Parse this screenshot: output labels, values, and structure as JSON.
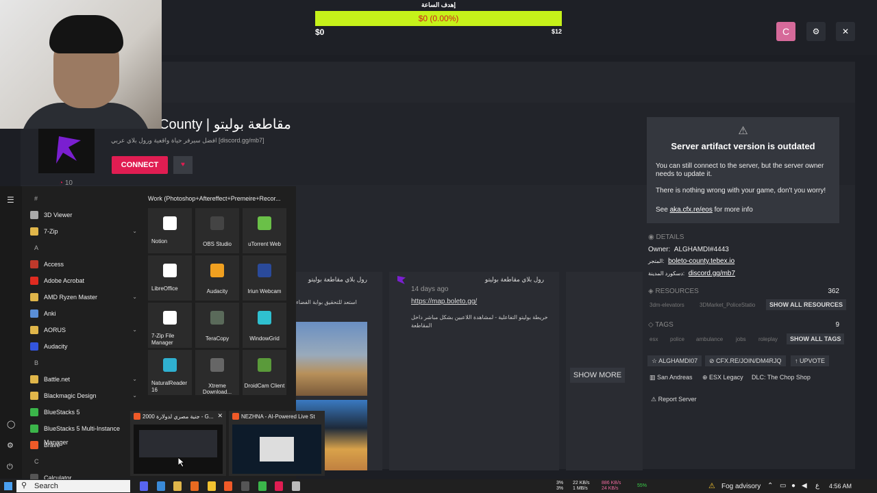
{
  "goal": {
    "title": "إهدف الساعة",
    "bar_text": "$0 (0.00%)",
    "progress": 0.0,
    "min_label": "$0",
    "max_label": "$12",
    "bar_color": "#c6f21a",
    "text_color": "#d0211a"
  },
  "window_controls": {
    "avatar_letter": "C",
    "settings_icon": "⚙",
    "close_icon": "✕"
  },
  "server": {
    "name": "County | مقاطعة بوليتو",
    "description": "افضل سيرفر حياة واقعية ورول بلاي عربي [discord.gg/mb7]",
    "connect_label": "CONNECT",
    "heart_icon": "♥",
    "player_count": "10",
    "accent": "#e01d52"
  },
  "warning": {
    "icon": "⚠",
    "title": "Server artifact version is outdated",
    "p1": "You can still connect to the server, but the server owner needs to update it.",
    "p2": "There is nothing wrong with your game, don't you worry!",
    "p3_prefix": "See",
    "p3_link": "aka.cfx.re/eos",
    "p3_suffix": "for more info"
  },
  "details": {
    "heading": "DETAILS",
    "owner_label": "Owner:",
    "owner_value": "ALGHAMDI#4443",
    "store_label": "المتجر:",
    "store_value": "boleto-county.tebex.io",
    "discord_label": "دسكورد المدينة:",
    "discord_value": "discord.gg/mb7"
  },
  "resources": {
    "heading": "RESOURCES",
    "count": "362",
    "items": [
      "3dm-elevators",
      "3DMarket_PoliceStatio"
    ],
    "show_all": "SHOW ALL RESOURCES"
  },
  "tags": {
    "heading": "TAGS",
    "count": "9",
    "items": [
      "esx",
      "police",
      "ambulance",
      "jobs",
      "roleplay"
    ],
    "show_all": "SHOW ALL TAGS"
  },
  "pills": [
    "ALGHAMDI07",
    "CFX.RE/JOIN/DM4RJQ",
    "UPVOTE",
    "San Andreas",
    "ESX Legacy",
    "DLC: The Chop Shop"
  ],
  "report": "Report Server",
  "posts": [
    {
      "title": "رول بلاي مقاطعة بوليتو",
      "body": "استعد للتحقيق بوابة الفضاء"
    },
    {
      "title": "رول بلاي مقاطعة بوليتو",
      "time": "14 days ago",
      "link": "https://map.boleto.gg/",
      "body": "خريطة بوليتو التفاعلية - لمشاهدة اللاعبين بشكل مباشر داخل المقاطعة"
    }
  ],
  "show_more": "SHOW MORE",
  "start_menu": {
    "apps": [
      {
        "type": "letter",
        "label": "#"
      },
      {
        "type": "app",
        "label": "3D Viewer",
        "color": "#aaaaaa"
      },
      {
        "type": "app",
        "label": "7-Zip",
        "color": "#e0b64a",
        "chevron": true
      },
      {
        "type": "letter",
        "label": "A"
      },
      {
        "type": "app",
        "label": "Access",
        "color": "#c0392b"
      },
      {
        "type": "app",
        "label": "Adobe Acrobat",
        "color": "#e02b20"
      },
      {
        "type": "app",
        "label": "AMD Ryzen Master",
        "color": "#e0b64a",
        "chevron": true
      },
      {
        "type": "app",
        "label": "Anki",
        "color": "#5a8fd8"
      },
      {
        "type": "app",
        "label": "AORUS",
        "color": "#e0b64a",
        "chevron": true
      },
      {
        "type": "app",
        "label": "Audacity",
        "color": "#3355dd"
      },
      {
        "type": "letter",
        "label": "B"
      },
      {
        "type": "app",
        "label": "Battle.net",
        "color": "#e0b64a",
        "chevron": true
      },
      {
        "type": "app",
        "label": "Blackmagic Design",
        "color": "#e0b64a",
        "chevron": true
      },
      {
        "type": "app",
        "label": "BlueStacks 5",
        "color": "#3bb54a"
      },
      {
        "type": "app",
        "label": "BlueStacks 5 Multi-Instance Manager",
        "color": "#3bb54a"
      },
      {
        "type": "app",
        "label": "Brave",
        "color": "#f05a28"
      },
      {
        "type": "letter",
        "label": "C"
      },
      {
        "type": "app",
        "label": "Calculator",
        "color": "#555555"
      }
    ],
    "group_title": "Work (Photoshop+Aftereffect+Premeire+Recor...",
    "tiles": [
      {
        "label": "Notion",
        "color": "#ffffff"
      },
      {
        "label": "OBS Studio",
        "color": "#444444"
      },
      {
        "label": "uTorrent Web",
        "color": "#6ac048"
      },
      {
        "label": "LibreOffice",
        "color": "#ffffff"
      },
      {
        "label": "Audacity",
        "color": "#f0a020"
      },
      {
        "label": "Iriun Webcam",
        "color": "#2a4a9a"
      },
      {
        "label": "7-Zip File Manager",
        "color": "#ffffff"
      },
      {
        "label": "TeraCopy",
        "color": "#5a6a5a"
      },
      {
        "label": "WindowGrid",
        "color": "#2fc0d0"
      },
      {
        "label": "NaturalReader 16",
        "color": "#2fb0d0"
      },
      {
        "label": "Xtreme Download...",
        "color": "#666666"
      },
      {
        "label": "DroidCam Client",
        "color": "#5a9a3a"
      }
    ]
  },
  "previews": [
    {
      "title": "2000 جنية مصري لدولارة - G...",
      "close": "✕"
    },
    {
      "title": "NEZHNA - AI-Powered Live Str..."
    }
  ],
  "taskbar": {
    "search_placeholder": "Search",
    "cpu": "3%",
    "cpu2": "3%",
    "net_up": "22 KB/s",
    "net_down": "1 MB/s",
    "net_up2": "886 KB/s",
    "net_down2": "24 KB/s",
    "battery": "55%",
    "weather": "Fog advisory",
    "lang": "ع",
    "time": "4:56 AM"
  }
}
